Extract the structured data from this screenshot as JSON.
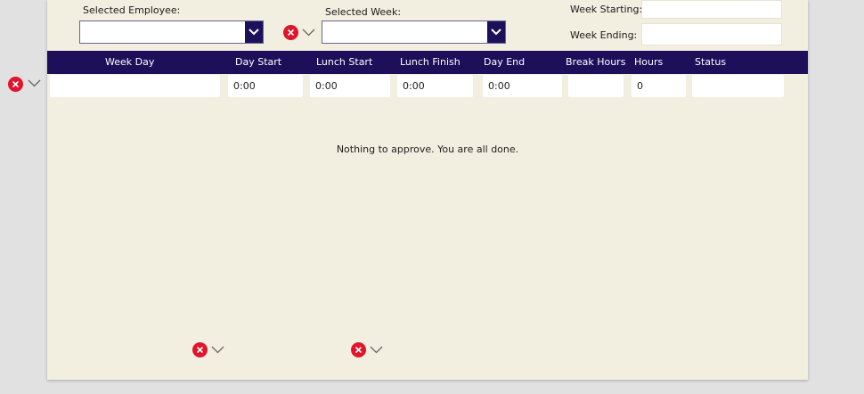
{
  "filters": {
    "employee_label": "Selected Employee:",
    "employee_value": "",
    "week_label": "Selected Week:",
    "week_value": "",
    "week_starting_label": "Week Starting:",
    "week_starting_value": "",
    "week_ending_label": "Week Ending:",
    "week_ending_value": ""
  },
  "table": {
    "headers": [
      "Week Day",
      "Day Start",
      "Lunch Start",
      "Lunch Finish",
      "Day End",
      "Break Hours",
      "Hours",
      "Status"
    ],
    "row": [
      "",
      "0:00",
      "0:00",
      "0:00",
      "0:00",
      "",
      "0",
      ""
    ]
  },
  "empty_message": "Nothing to approve. You are all done.",
  "colors": {
    "header_bg": "#1e0f5a",
    "panel_bg": "#f2eee0",
    "error": "#e0142a"
  },
  "icons": [
    "chevron-down-icon",
    "error-icon"
  ]
}
